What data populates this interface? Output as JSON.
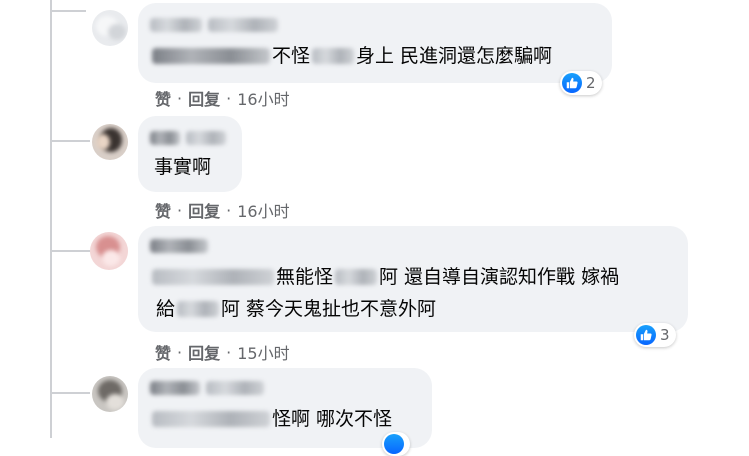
{
  "comments": [
    {
      "text_before": "不怪",
      "text_after": "身上 民進洞還怎麼騙啊",
      "actions": {
        "like": "赞",
        "reply": "回复",
        "time": "16小时"
      },
      "reactions": "2"
    },
    {
      "text": "事實啊",
      "actions": {
        "like": "赞",
        "reply": "回复",
        "time": "16小时"
      }
    },
    {
      "line1_before": "無能怪",
      "line1_after": "阿 還自導自演認知作戰 嫁禍",
      "line2_before": "給",
      "line2_after": "阿 蔡今天鬼扯也不意外阿",
      "actions": {
        "like": "赞",
        "reply": "回复",
        "time": "15小时"
      },
      "reactions": "3"
    },
    {
      "text": "怪啊 哪次不怪"
    }
  ],
  "colors": {
    "bubble": "#f0f2f5",
    "meta_text": "#65676b",
    "like_blue": "#0866ff",
    "thread_line": "#ced0d4"
  },
  "icons": {
    "reaction": "like-thumbs-up-icon"
  }
}
